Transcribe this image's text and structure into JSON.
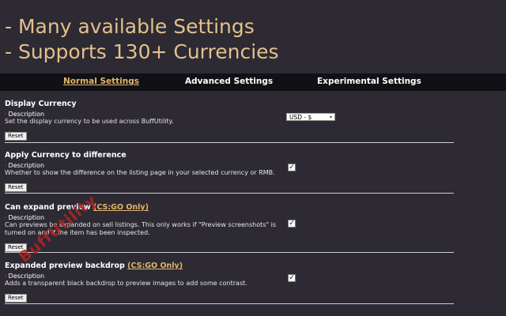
{
  "promo": {
    "line1": "- Many available Settings",
    "line2": "- Supports 130+ Currencies"
  },
  "tabs": [
    {
      "label": "Normal Settings",
      "active": true
    },
    {
      "label": "Advanced Settings",
      "active": false
    },
    {
      "label": "Experimental Settings",
      "active": false
    }
  ],
  "common": {
    "description_label": "Description",
    "reset_label": "Reset"
  },
  "settings": [
    {
      "title": "Display Currency",
      "tag": "",
      "description_lines": [
        "Set the display currency to be used across BuffUtility."
      ],
      "control": "select",
      "value": "USD - $"
    },
    {
      "title": "Apply Currency to difference",
      "tag": "",
      "description_lines": [
        "Whether to show the difference on the listing page in your selected currency or RMB."
      ],
      "control": "checkbox",
      "checked": true
    },
    {
      "title": "Can expand preview",
      "tag": "(CS:GO Only)",
      "description_lines": [
        "Can previews be expanded on sell listings. This only works if \"Preview screenshots\" is",
        "turned on and if the item has been inspected."
      ],
      "control": "checkbox",
      "checked": true
    },
    {
      "title": "Expanded preview backdrop",
      "tag": "(CS:GO Only)",
      "description_lines": [
        "Adds a transparent black backdrop to preview images to add some contrast."
      ],
      "control": "checkbox",
      "checked": true
    }
  ],
  "icons": {
    "check": "check-icon",
    "chevron": "chevron-down-icon"
  },
  "watermark": "BuffUtility",
  "colors": {
    "background": "#2d2a33",
    "promo_text": "#e2c18b",
    "accent": "#e2b56a",
    "tab_bar": "#111015"
  }
}
